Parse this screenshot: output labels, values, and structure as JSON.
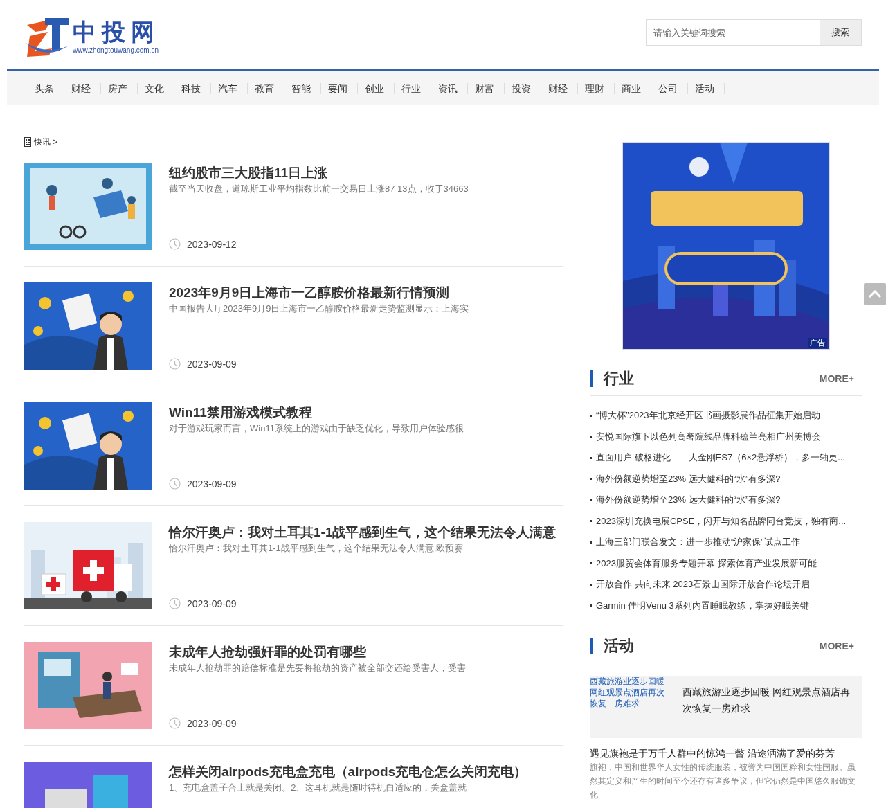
{
  "header": {
    "logo": {
      "name": "中投网",
      "url": "www.zhongtouwang.com.cn"
    },
    "search": {
      "placeholder": "请输入关键词搜索",
      "button": "搜索"
    }
  },
  "nav": {
    "items": [
      "头条",
      "财经",
      "房产",
      "文化",
      "科技",
      "汽车",
      "教育",
      "智能",
      "要闻",
      "创业",
      "行业",
      "资讯",
      "财富",
      "投资",
      "财经",
      "理财",
      "商业",
      "公司",
      "活动"
    ]
  },
  "breadcrumb": {
    "label": "快讯 >"
  },
  "articles": [
    {
      "title": "纽约股市三大股指11日上涨",
      "summary": "截至当天收盘，道琼斯工业平均指数比前一交易日上涨87 13点，收于34663",
      "date": "2023-09-12"
    },
    {
      "title": "2023年9月9日上海市一乙醇胺价格最新行情预测",
      "summary": "中国报告大厅2023年9月9日上海市一乙醇胺价格最新走势监测显示：上海实",
      "date": "2023-09-09"
    },
    {
      "title": "Win11禁用游戏模式教程",
      "summary": "对于游戏玩家而言，Win11系统上的游戏由于缺乏优化，导致用户体验感很",
      "date": "2023-09-09"
    },
    {
      "title": "恰尔汗奥卢：我对土耳其1-1战平感到生气，这个结果无法令人满意",
      "summary": "恰尔汗奥卢：我对土耳其1-1战平感到生气，这个结果无法令人满意,欧预赛",
      "date": "2023-09-09"
    },
    {
      "title": "未成年人抢劫强奸罪的处罚有哪些",
      "summary": "未成年人抢劫罪的赔偿标准是先要将抢劫的资产被全部交还给受害人，受害",
      "date": "2023-09-09"
    },
    {
      "title": "怎样关闭airpods充电盒充电（airpods充电仓怎么关闭充电）",
      "summary": "1、充电盒盖子合上就是关闭。2、这耳机就是随时待机自适应的，关盒盖就"
    }
  ],
  "ad": {
    "badge": "广告"
  },
  "industry": {
    "title": "行业",
    "more": "MORE+",
    "items": [
      "“博大杯”2023年北京经开区书画摄影展作品征集开始启动",
      "安悦国际旗下以色列高奢院线品牌科蕴兰亮相广州美博会",
      "直面用户 破格进化——大金刚ES7（6×2悬浮桥），多一轴更...",
      "海外份额逆势增至23% 远大健科的“水”有多深?",
      "海外份额逆势增至23% 远大健科的“水”有多深?",
      "2023深圳充换电展CPSE，闪开与知名品牌同台竞技，独有商...",
      "上海三部门联合发文：进一步推动“沪家保”试点工作",
      "2023服贸会体育服务专题开幕 探索体育产业发展新可能",
      "开放合作 共向未来 2023石景山国际开放合作论坛开启",
      "Garmin 佳明Venu 3系列内置睡眠教练，掌握好眠关键"
    ]
  },
  "activity": {
    "title": "活动",
    "more": "MORE+",
    "feature": {
      "link": "西藏旅游业逐步回暖网红观景点酒店再次恢复一房难求",
      "title": "西藏旅游业逐步回暖 网红观景点酒店再次恢复一房难求"
    },
    "story": {
      "title": "遇见旗袍是于万千人群中的惊鸿一瞥 沿途洒满了爱的芬芳",
      "summary": "旗袍，中国和世界华人女性的传统服装，被誉为中国国粹和女性国服。虽然其定义和产生的时间至今还存有诸多争议，但它仍然是中国悠久服饰文化"
    }
  }
}
